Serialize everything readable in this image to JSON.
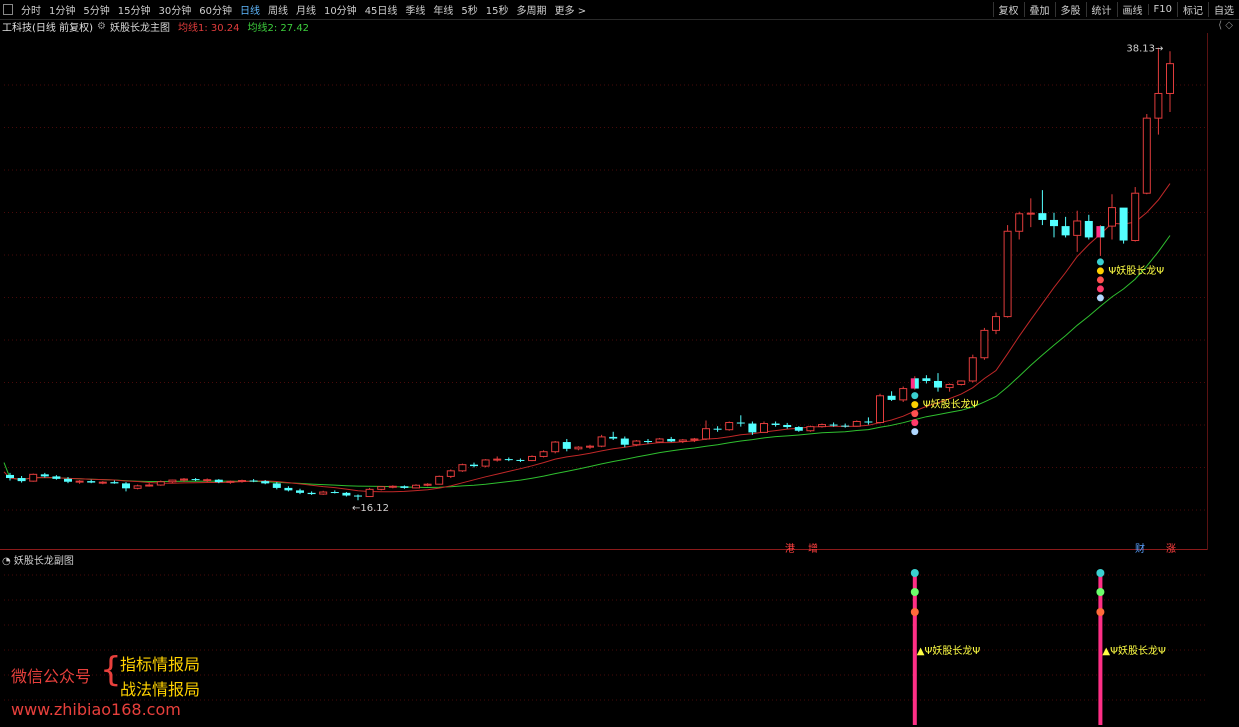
{
  "toolbar": {
    "periods": [
      "分时",
      "1分钟",
      "5分钟",
      "15分钟",
      "30分钟",
      "60分钟",
      "日线",
      "周线",
      "月线",
      "10分钟",
      "45日线",
      "季线",
      "年线",
      "5秒",
      "15秒",
      "多周期",
      "更多 >"
    ],
    "active": "日线",
    "right": [
      "复权",
      "叠加",
      "多股",
      "统计",
      "画线",
      "F10",
      "标记",
      "自选"
    ]
  },
  "info": {
    "stock": "工科技(日线 前复权)",
    "indicator": "妖股长龙主图",
    "ma1": "均线1: 30.24",
    "ma2": "均线2: 27.42"
  },
  "price_labels": {
    "high": "38.13",
    "low": "16.12"
  },
  "signal_label": "Ψ妖股长龙Ψ",
  "sub_signal_label": "▲Ψ妖股长龙Ψ",
  "bottom_tags": [
    "港",
    "增",
    "财",
    "涨"
  ],
  "sub_panel_title": "妖股长龙副图",
  "watermark": {
    "label": "微信公众号",
    "brace": "{",
    "line1": "指标情报局",
    "line2": "战法情报局",
    "url": "www.zhibiao168.com"
  },
  "colors": {
    "up": "#e03c3c",
    "down": "#54ffff",
    "ma1": "#c02828",
    "ma2": "#2fbf2f",
    "signal": "#ff2f86",
    "text_yellow": "#ffff44"
  },
  "chart_data": {
    "type": "candlestick",
    "ohlc": [
      [
        17.35,
        17.45,
        17.08,
        17.2
      ],
      [
        17.2,
        17.3,
        16.98,
        17.05
      ],
      [
        17.05,
        17.42,
        17.02,
        17.38
      ],
      [
        17.38,
        17.45,
        17.22,
        17.28
      ],
      [
        17.28,
        17.34,
        17.12,
        17.16
      ],
      [
        17.16,
        17.25,
        16.95,
        17.02
      ],
      [
        17.02,
        17.1,
        16.92,
        17.05
      ],
      [
        17.05,
        17.12,
        16.95,
        16.98
      ],
      [
        16.98,
        17.05,
        16.9,
        17.0
      ],
      [
        17.0,
        17.08,
        16.92,
        16.94
      ],
      [
        16.94,
        17.0,
        16.55,
        16.7
      ],
      [
        16.7,
        16.88,
        16.65,
        16.82
      ],
      [
        16.82,
        16.95,
        16.78,
        16.86
      ],
      [
        16.86,
        17.08,
        16.82,
        17.02
      ],
      [
        17.02,
        17.12,
        16.96,
        17.1
      ],
      [
        17.1,
        17.2,
        17.02,
        17.15
      ],
      [
        17.15,
        17.2,
        17.05,
        17.1
      ],
      [
        17.1,
        17.18,
        17.0,
        17.12
      ],
      [
        17.12,
        17.15,
        16.95,
        17.0
      ],
      [
        17.0,
        17.08,
        16.92,
        17.04
      ],
      [
        17.04,
        17.12,
        16.98,
        17.08
      ],
      [
        17.08,
        17.15,
        17.0,
        17.05
      ],
      [
        17.05,
        17.1,
        16.9,
        16.94
      ],
      [
        16.94,
        17.0,
        16.65,
        16.72
      ],
      [
        16.72,
        16.8,
        16.55,
        16.6
      ],
      [
        16.6,
        16.68,
        16.42,
        16.48
      ],
      [
        16.48,
        16.55,
        16.38,
        16.42
      ],
      [
        16.42,
        16.58,
        16.38,
        16.52
      ],
      [
        16.52,
        16.6,
        16.45,
        16.48
      ],
      [
        16.48,
        16.52,
        16.3,
        16.35
      ],
      [
        16.35,
        16.4,
        16.12,
        16.3
      ],
      [
        16.3,
        16.72,
        16.28,
        16.65
      ],
      [
        16.65,
        16.8,
        16.6,
        16.78
      ],
      [
        16.78,
        16.85,
        16.7,
        16.8
      ],
      [
        16.8,
        16.84,
        16.68,
        16.72
      ],
      [
        16.72,
        16.9,
        16.7,
        16.85
      ],
      [
        16.85,
        16.95,
        16.8,
        16.9
      ],
      [
        16.9,
        17.32,
        16.88,
        17.28
      ],
      [
        17.28,
        17.62,
        17.2,
        17.55
      ],
      [
        17.55,
        17.9,
        17.5,
        17.85
      ],
      [
        17.85,
        17.95,
        17.72,
        17.78
      ],
      [
        17.78,
        18.12,
        17.72,
        18.08
      ],
      [
        18.08,
        18.25,
        18.0,
        18.12
      ],
      [
        18.12,
        18.2,
        18.02,
        18.08
      ],
      [
        18.08,
        18.15,
        17.98,
        18.05
      ],
      [
        18.05,
        18.3,
        18.02,
        18.25
      ],
      [
        18.25,
        18.55,
        18.2,
        18.48
      ],
      [
        18.48,
        19.0,
        18.4,
        18.95
      ],
      [
        18.95,
        19.1,
        18.5,
        18.62
      ],
      [
        18.62,
        18.75,
        18.55,
        18.7
      ],
      [
        18.7,
        18.82,
        18.62,
        18.75
      ],
      [
        18.75,
        19.3,
        18.7,
        19.2
      ],
      [
        19.2,
        19.45,
        19.05,
        19.12
      ],
      [
        19.12,
        19.22,
        18.7,
        18.82
      ],
      [
        18.82,
        19.05,
        18.75,
        19.0
      ],
      [
        19.0,
        19.1,
        18.88,
        18.95
      ],
      [
        18.95,
        19.15,
        18.9,
        19.1
      ],
      [
        19.1,
        19.2,
        18.95,
        18.98
      ],
      [
        18.98,
        19.1,
        18.9,
        19.05
      ],
      [
        19.05,
        19.15,
        18.95,
        19.1
      ],
      [
        19.1,
        20.0,
        19.05,
        19.6
      ],
      [
        19.6,
        19.72,
        19.45,
        19.55
      ],
      [
        19.55,
        19.95,
        19.5,
        19.9
      ],
      [
        19.9,
        20.25,
        19.7,
        19.85
      ],
      [
        19.85,
        19.95,
        19.3,
        19.42
      ],
      [
        19.42,
        19.95,
        19.4,
        19.85
      ],
      [
        19.85,
        19.95,
        19.7,
        19.78
      ],
      [
        19.78,
        19.88,
        19.6,
        19.68
      ],
      [
        19.68,
        19.72,
        19.45,
        19.5
      ],
      [
        19.5,
        19.75,
        19.45,
        19.7
      ],
      [
        19.7,
        19.85,
        19.65,
        19.8
      ],
      [
        19.8,
        19.9,
        19.7,
        19.75
      ],
      [
        19.75,
        19.85,
        19.65,
        19.72
      ],
      [
        19.72,
        20.0,
        19.7,
        19.95
      ],
      [
        19.95,
        20.15,
        19.8,
        19.9
      ],
      [
        19.9,
        21.3,
        19.85,
        21.2
      ],
      [
        21.2,
        21.42,
        20.95,
        21.0
      ],
      [
        21.0,
        21.65,
        20.9,
        21.55
      ],
      [
        21.55,
        22.15,
        21.5,
        22.05
      ],
      [
        22.05,
        22.2,
        21.8,
        21.92
      ],
      [
        21.92,
        22.3,
        21.4,
        21.6
      ],
      [
        21.6,
        21.8,
        21.4,
        21.75
      ],
      [
        21.75,
        21.95,
        21.7,
        21.92
      ],
      [
        21.92,
        23.2,
        21.85,
        23.05
      ],
      [
        23.05,
        24.5,
        22.95,
        24.38
      ],
      [
        24.38,
        25.25,
        24.2,
        25.05
      ],
      [
        25.05,
        29.5,
        25.0,
        29.2
      ],
      [
        29.2,
        30.15,
        28.8,
        30.05
      ],
      [
        30.05,
        30.8,
        29.4,
        30.08
      ],
      [
        30.08,
        31.2,
        29.5,
        29.75
      ],
      [
        29.75,
        30.1,
        28.9,
        29.45
      ],
      [
        29.45,
        29.9,
        28.9,
        29.0
      ],
      [
        29.0,
        30.2,
        28.2,
        29.7
      ],
      [
        29.7,
        30.0,
        28.8,
        28.9
      ],
      [
        28.9,
        29.5,
        28.0,
        29.45
      ],
      [
        29.45,
        31.0,
        28.8,
        30.35
      ],
      [
        30.35,
        29.9,
        28.6,
        28.75
      ],
      [
        28.75,
        31.35,
        28.7,
        31.05
      ],
      [
        31.05,
        34.9,
        31.0,
        34.7
      ],
      [
        34.7,
        38.13,
        33.9,
        35.9
      ],
      [
        35.9,
        37.95,
        35.0,
        37.35
      ]
    ],
    "price_range": [
      15.5,
      38.5
    ],
    "signal_bars": [
      78,
      94
    ],
    "ma_period_fast": 10,
    "ma_period_slow": 20
  }
}
